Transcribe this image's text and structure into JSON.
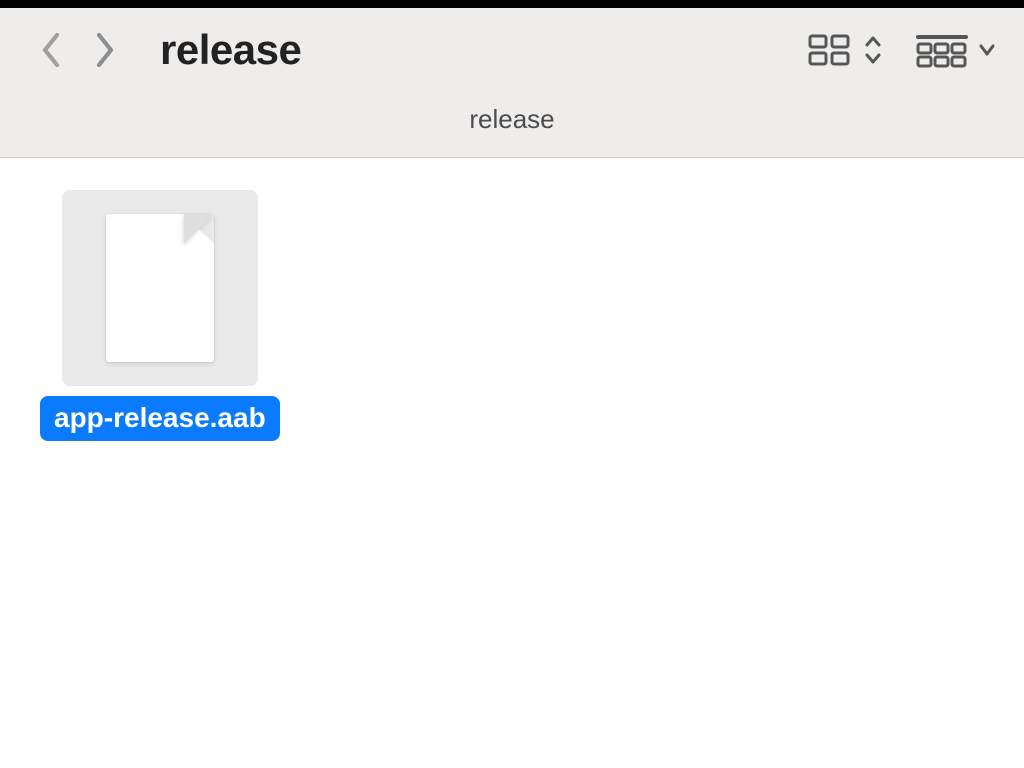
{
  "header": {
    "folder_title": "release"
  },
  "path": {
    "current": "release"
  },
  "files": [
    {
      "name": "app-release.aab",
      "selected": true
    }
  ],
  "colors": {
    "selection": "#0a7aff",
    "header_bg": "#efedec"
  }
}
